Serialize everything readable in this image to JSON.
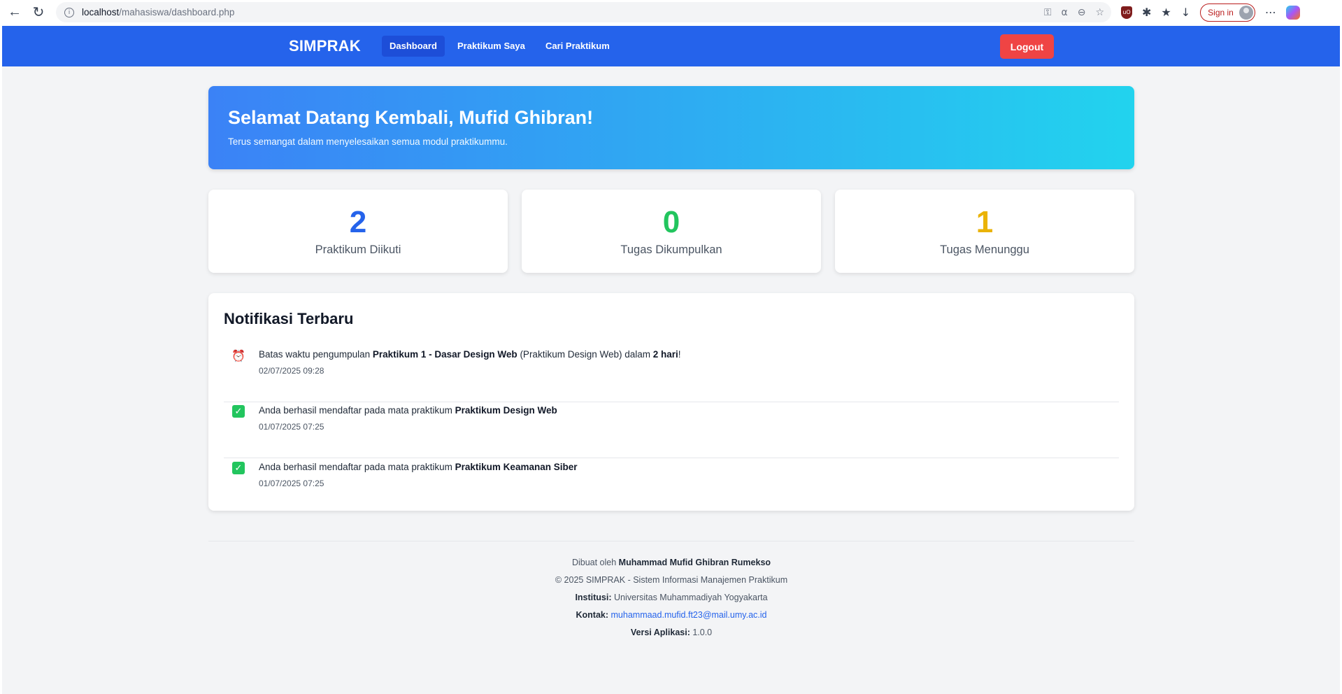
{
  "browser": {
    "url_host": "localhost",
    "url_path": "/mahasiswa/dashboard.php",
    "signin_label": "Sign in"
  },
  "navbar": {
    "brand": "SIMPRAK",
    "links": [
      {
        "label": "Dashboard",
        "active": true
      },
      {
        "label": "Praktikum Saya",
        "active": false
      },
      {
        "label": "Cari Praktikum",
        "active": false
      }
    ],
    "logout_label": "Logout"
  },
  "banner": {
    "title": "Selamat Datang Kembali, Mufid Ghibran!",
    "subtitle": "Terus semangat dalam menyelesaikan semua modul praktikummu."
  },
  "stats": [
    {
      "value": "2",
      "label": "Praktikum Diikuti",
      "color": "#2563eb"
    },
    {
      "value": "0",
      "label": "Tugas Dikumpulkan",
      "color": "#22c55e"
    },
    {
      "value": "1",
      "label": "Tugas Menunggu",
      "color": "#eab308"
    }
  ],
  "notifications": {
    "title": "Notifikasi Terbaru",
    "items": [
      {
        "icon": "alarm-clock-icon",
        "parts": [
          "Batas waktu pengumpulan ",
          "Praktikum 1 - Dasar Design Web",
          " (Praktikum Design Web) dalam ",
          "2 hari",
          "!"
        ],
        "time": "02/07/2025 09:28"
      },
      {
        "icon": "check-box-icon",
        "parts": [
          "Anda berhasil mendaftar pada mata praktikum ",
          "Praktikum Design Web"
        ],
        "time": "01/07/2025 07:25"
      },
      {
        "icon": "check-box-icon",
        "parts": [
          "Anda berhasil mendaftar pada mata praktikum ",
          "Praktikum Keamanan Siber"
        ],
        "time": "01/07/2025 07:25"
      }
    ]
  },
  "footer": {
    "made_by_prefix": "Dibuat oleh ",
    "made_by_name": "Muhammad Mufid Ghibran Rumekso",
    "copyright": "© 2025 SIMPRAK - Sistem Informasi Manajemen Praktikum",
    "institution_label": "Institusi:",
    "institution_value": " Universitas Muhammadiyah Yogyakarta",
    "contact_label": "Kontak:",
    "contact_value": "muhammaad.mufid.ft23@mail.umy.ac.id",
    "version_label": "Versi Aplikasi:",
    "version_value": " 1.0.0"
  }
}
